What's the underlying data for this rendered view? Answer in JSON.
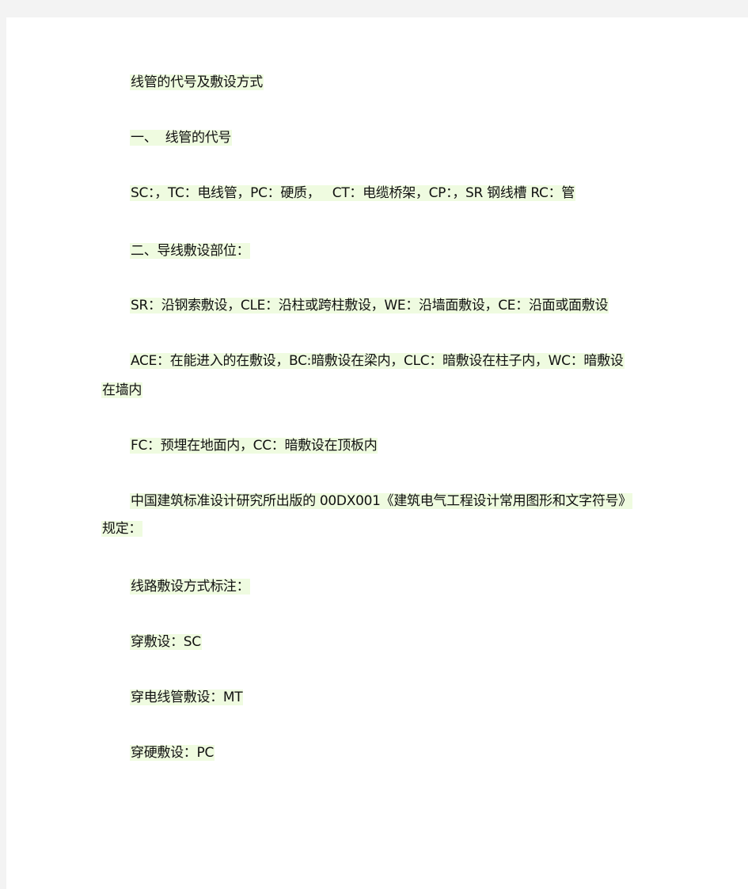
{
  "document": {
    "title": "线管的代号及敷设方式",
    "section1": {
      "heading": "一、  线管的代号",
      "codes": "SC：，TC：电线管，PC：硬质，   CT：电缆桥架，CP：，SR 钢线槽 RC：管"
    },
    "section2": {
      "heading": "二、导线敷设部位：",
      "line1": "SR：沿钢索敷设，CLE：沿柱或跨柱敷设，WE：沿墙面敷设，CE：沿面或面敷设",
      "line2_part1": "ACE：在能进入的在敷设，BC:暗敷设在梁内，CLC：暗敷设在柱子内，WC：暗敷设",
      "line2_part2": "在墙内",
      "line3": "FC：预埋在地面内，CC：暗敷设在顶板内"
    },
    "standard": {
      "text_part1": "中国建筑标准设计研究所出版的 00DX001《建筑电气工程设计常用图形和文字符号》",
      "text_part2": "规定："
    },
    "marking": {
      "heading": "线路敷设方式标注：",
      "items": [
        "穿敷设：SC",
        "穿电线管敷设：MT",
        "穿硬敷设：PC"
      ]
    }
  }
}
